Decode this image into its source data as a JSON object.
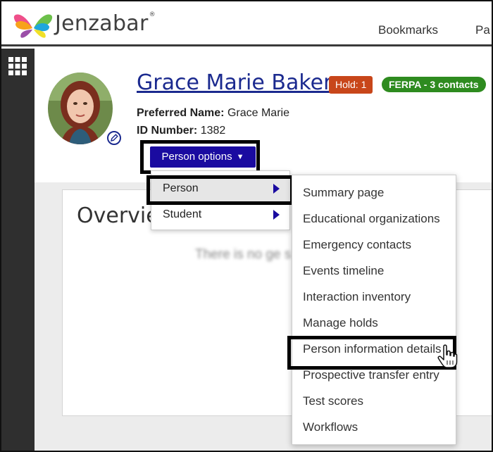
{
  "header": {
    "brand": "Jenzabar",
    "brand_tm": "®",
    "nav": [
      "Bookmarks",
      "Pa"
    ]
  },
  "person": {
    "name": "Grace Marie Baker",
    "hold_badge": "Hold: 1",
    "ferpa_badge": "FERPA - 3 contacts",
    "preferred_label": "Preferred Name:",
    "preferred_value": "Grace Marie",
    "id_label": "ID Number:",
    "id_value": "1382"
  },
  "person_options": {
    "label": "Person options",
    "menu": [
      "Person",
      "Student"
    ]
  },
  "person_submenu": [
    "Summary page",
    "Educational organizations",
    "Emergency contacts",
    "Events timeline",
    "Interaction inventory",
    "Manage holds",
    "Person information details",
    "Prospective transfer entry",
    "Test scores",
    "Workflows"
  ],
  "overview": {
    "title": "Overvie",
    "blurred_message": "There is no ge                     s at th"
  },
  "colors": {
    "accent_blue": "#1a0ba0",
    "link_blue": "#1b2a8f",
    "hold_orange": "#c8461a",
    "ferpa_green": "#2e8b1f",
    "rail_dark": "#2f2f2f"
  },
  "icons": [
    "jenzabar-butterfly-logo-icon",
    "apps-grid-icon",
    "edit-photo-icon",
    "caret-down-icon",
    "submenu-arrow-icon",
    "hand-pointer-cursor-icon"
  ]
}
